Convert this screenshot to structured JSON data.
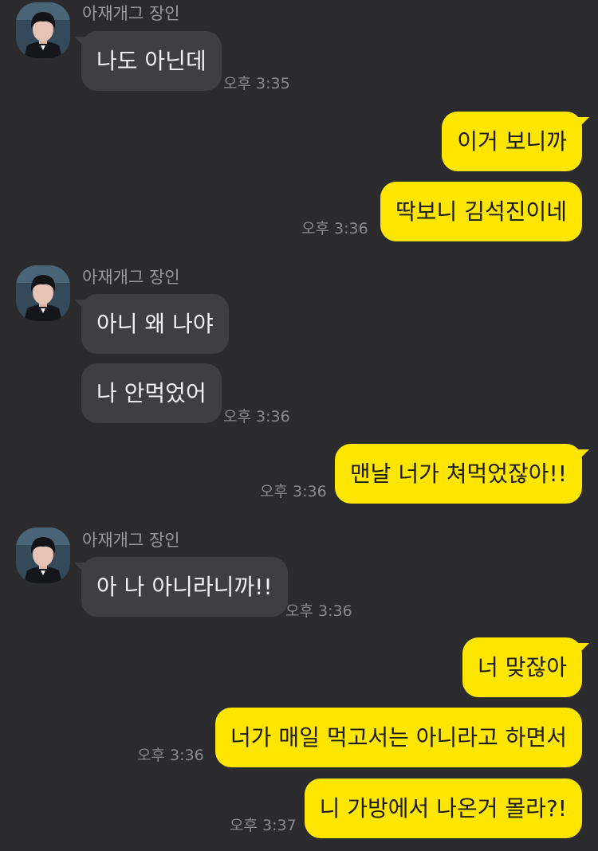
{
  "sender_name": "아재개그 장인",
  "colors": {
    "background": "#2b2b2d",
    "incoming_bubble": "#3f3f42",
    "outgoing_bubble": "#ffe600"
  },
  "messages": [
    {
      "text": "나도 아닌데",
      "time": "오후 3:35"
    },
    {
      "text": "이거 보니까"
    },
    {
      "text": "딱보니 김석진이네",
      "time": "오후 3:36"
    },
    {
      "text": "아니 왜 나야"
    },
    {
      "text": "나 안먹었어",
      "time": "오후 3:36"
    },
    {
      "text": "맨날 너가 쳐먹었잖아!!",
      "time": "오후 3:36"
    },
    {
      "text": "아 나 아니라니까!!",
      "time": "오후 3:36"
    },
    {
      "text": "너 맞잖아"
    },
    {
      "text": "너가 매일 먹고서는 아니라고 하면서",
      "time": "오후 3:36"
    },
    {
      "text": "니 가방에서 나온거 몰라?!",
      "time": "오후 3:37"
    }
  ]
}
